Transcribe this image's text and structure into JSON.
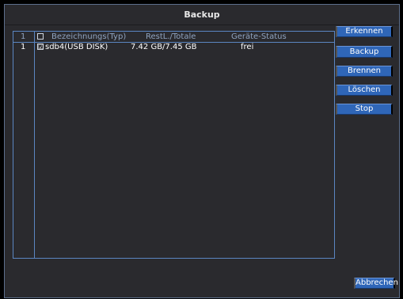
{
  "window": {
    "title": "Backup"
  },
  "table": {
    "headers": {
      "index": "1",
      "name": "Bezeichnungs(Typ)",
      "rest": "RestL./Totale",
      "status": "Geräte-Status"
    },
    "rows": [
      {
        "index": "1",
        "checked": "☑",
        "name": "sdb4(USB DISK)",
        "rest": "7.42 GB/7.45 GB",
        "status": "frei"
      }
    ]
  },
  "buttons": {
    "scan": "Erkennen",
    "backup": "Backup",
    "burn": "Brennen",
    "delete": "Löschen",
    "stop": "Stop",
    "cancel": "Abbrechen"
  },
  "colors": {
    "background": "#2a2a2e",
    "button": "#2f66b8",
    "border": "#5b86c2",
    "header_text": "#8fa3bf"
  }
}
